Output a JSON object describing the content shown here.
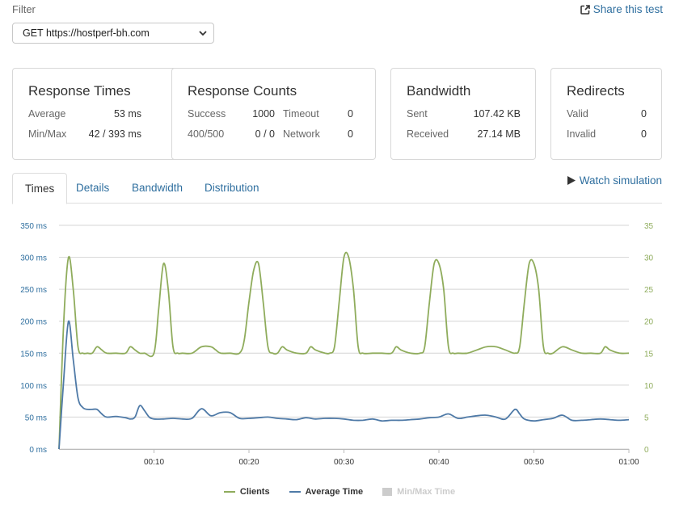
{
  "filter": {
    "label": "Filter",
    "selected": "GET https://hostperf-bh.com"
  },
  "share": {
    "label": "Share this test",
    "icon": "share-icon"
  },
  "cards": {
    "response_times": {
      "title": "Response Times",
      "rows": [
        {
          "label": "Average",
          "value": "53 ms"
        },
        {
          "label": "Min/Max",
          "value": "42 / 393 ms"
        }
      ]
    },
    "response_counts": {
      "title": "Response Counts",
      "rows": [
        {
          "label": "Success",
          "value": "1000",
          "label2": "Timeout",
          "value2": "0"
        },
        {
          "label": "400/500",
          "value": "0 / 0",
          "label2": "Network",
          "value2": "0"
        }
      ]
    },
    "bandwidth": {
      "title": "Bandwidth",
      "rows": [
        {
          "label": "Sent",
          "value": "107.42 KB"
        },
        {
          "label": "Received",
          "value": "27.14 MB"
        }
      ]
    },
    "redirects": {
      "title": "Redirects",
      "rows": [
        {
          "label": "Valid",
          "value": "0"
        },
        {
          "label": "Invalid",
          "value": "0"
        }
      ]
    }
  },
  "tabs": [
    {
      "label": "Times",
      "active": true
    },
    {
      "label": "Details",
      "active": false
    },
    {
      "label": "Bandwidth",
      "active": false
    },
    {
      "label": "Distribution",
      "active": false
    }
  ],
  "watch": {
    "label": "Watch simulation",
    "icon": "play-icon"
  },
  "colors": {
    "clients": "#8fac5c",
    "average": "#4f7aa7",
    "minmax": "#cccccc",
    "grid": "#d4d4d4",
    "link": "#2f6f9f"
  },
  "chart_data": {
    "type": "line",
    "x_ticks": [
      "00:10",
      "00:20",
      "00:30",
      "00:40",
      "00:50",
      "01:00"
    ],
    "x_range": [
      0,
      60
    ],
    "y_left_ticks": [
      "0 ms",
      "50 ms",
      "100 ms",
      "150 ms",
      "200 ms",
      "250 ms",
      "300 ms",
      "350 ms"
    ],
    "y_left_range": [
      0,
      350
    ],
    "y_right_ticks": [
      "0",
      "5",
      "10",
      "15",
      "20",
      "25",
      "30",
      "35"
    ],
    "y_right_range": [
      0,
      35
    ],
    "grid": true,
    "legend_position": "bottom",
    "legend": [
      {
        "name": "Clients",
        "kind": "line"
      },
      {
        "name": "Average Time",
        "kind": "line"
      },
      {
        "name": "Min/Max Time",
        "kind": "box",
        "disabled": true
      }
    ],
    "series": [
      {
        "name": "Clients",
        "axis": "right",
        "x": [
          0,
          0.5,
          1,
          1.5,
          2,
          2.5,
          3,
          3.5,
          4,
          4.5,
          5,
          6,
          7,
          7.5,
          8,
          8.5,
          9,
          10,
          10.5,
          11,
          11.5,
          12,
          12.5,
          13,
          14,
          15,
          16,
          16.5,
          17,
          18,
          19,
          19.5,
          20,
          20.5,
          21,
          21.5,
          22,
          22.5,
          23,
          23.5,
          24,
          25,
          26,
          26.5,
          27,
          28,
          28.5,
          29,
          29.5,
          30,
          30.5,
          31,
          31.5,
          32,
          33,
          34,
          35,
          35.5,
          36,
          37,
          38,
          38.5,
          39,
          39.5,
          40,
          40.5,
          41,
          41.5,
          42,
          43,
          44,
          45,
          46,
          47,
          48,
          48.5,
          49,
          49.5,
          50,
          50.5,
          51,
          51.5,
          52,
          53,
          54,
          55,
          56,
          57,
          57.5,
          58,
          59,
          60
        ],
        "values": [
          0,
          20,
          30,
          25,
          16,
          15,
          15,
          15,
          16,
          15.5,
          15,
          15,
          15,
          16,
          15.5,
          15,
          15,
          15,
          22,
          29,
          25,
          16,
          15,
          15,
          15,
          16,
          16,
          15.5,
          15,
          15,
          15,
          17,
          23,
          28,
          29,
          23,
          16,
          15,
          15,
          16,
          15.5,
          15,
          15,
          16,
          15.5,
          15,
          15,
          16,
          23,
          30,
          30,
          25,
          16,
          15,
          15,
          15,
          15,
          16,
          15.5,
          15,
          15,
          16,
          23,
          29,
          29,
          25,
          16,
          15,
          15,
          15,
          15.5,
          16,
          16,
          15.5,
          15,
          16,
          23,
          29,
          29,
          25,
          16,
          15,
          15,
          16,
          15.5,
          15,
          15,
          15,
          16,
          15.5,
          15,
          15
        ]
      },
      {
        "name": "Average Time",
        "axis": "left",
        "x": [
          0,
          0.5,
          1,
          1.5,
          2,
          2.5,
          3,
          3.5,
          4,
          4.5,
          5,
          6,
          7,
          7.5,
          8,
          8.5,
          9,
          9.5,
          10,
          11,
          12,
          13,
          14,
          15,
          16,
          17,
          18,
          19,
          20,
          21,
          22,
          23,
          24,
          25,
          26,
          27,
          28,
          29,
          30,
          31,
          32,
          33,
          34,
          35,
          36,
          37,
          38,
          39,
          40,
          41,
          42,
          43,
          44,
          45,
          46,
          47,
          48,
          48.5,
          49,
          50,
          51,
          52,
          53,
          54,
          55,
          56,
          57,
          58,
          59,
          60
        ],
        "values": [
          0,
          110,
          200,
          140,
          80,
          65,
          62,
          62,
          62,
          55,
          50,
          51,
          49,
          47,
          50,
          68,
          60,
          50,
          47,
          47,
          48,
          47,
          48,
          63,
          52,
          57,
          57,
          48,
          48,
          49,
          50,
          48,
          47,
          46,
          49,
          47,
          48,
          48,
          47,
          45,
          45,
          47,
          44,
          45,
          45,
          46,
          47,
          49,
          50,
          55,
          48,
          50,
          52,
          53,
          50,
          47,
          62,
          55,
          47,
          44,
          46,
          48,
          53,
          45,
          45,
          46,
          47,
          46,
          45,
          46
        ]
      }
    ]
  }
}
